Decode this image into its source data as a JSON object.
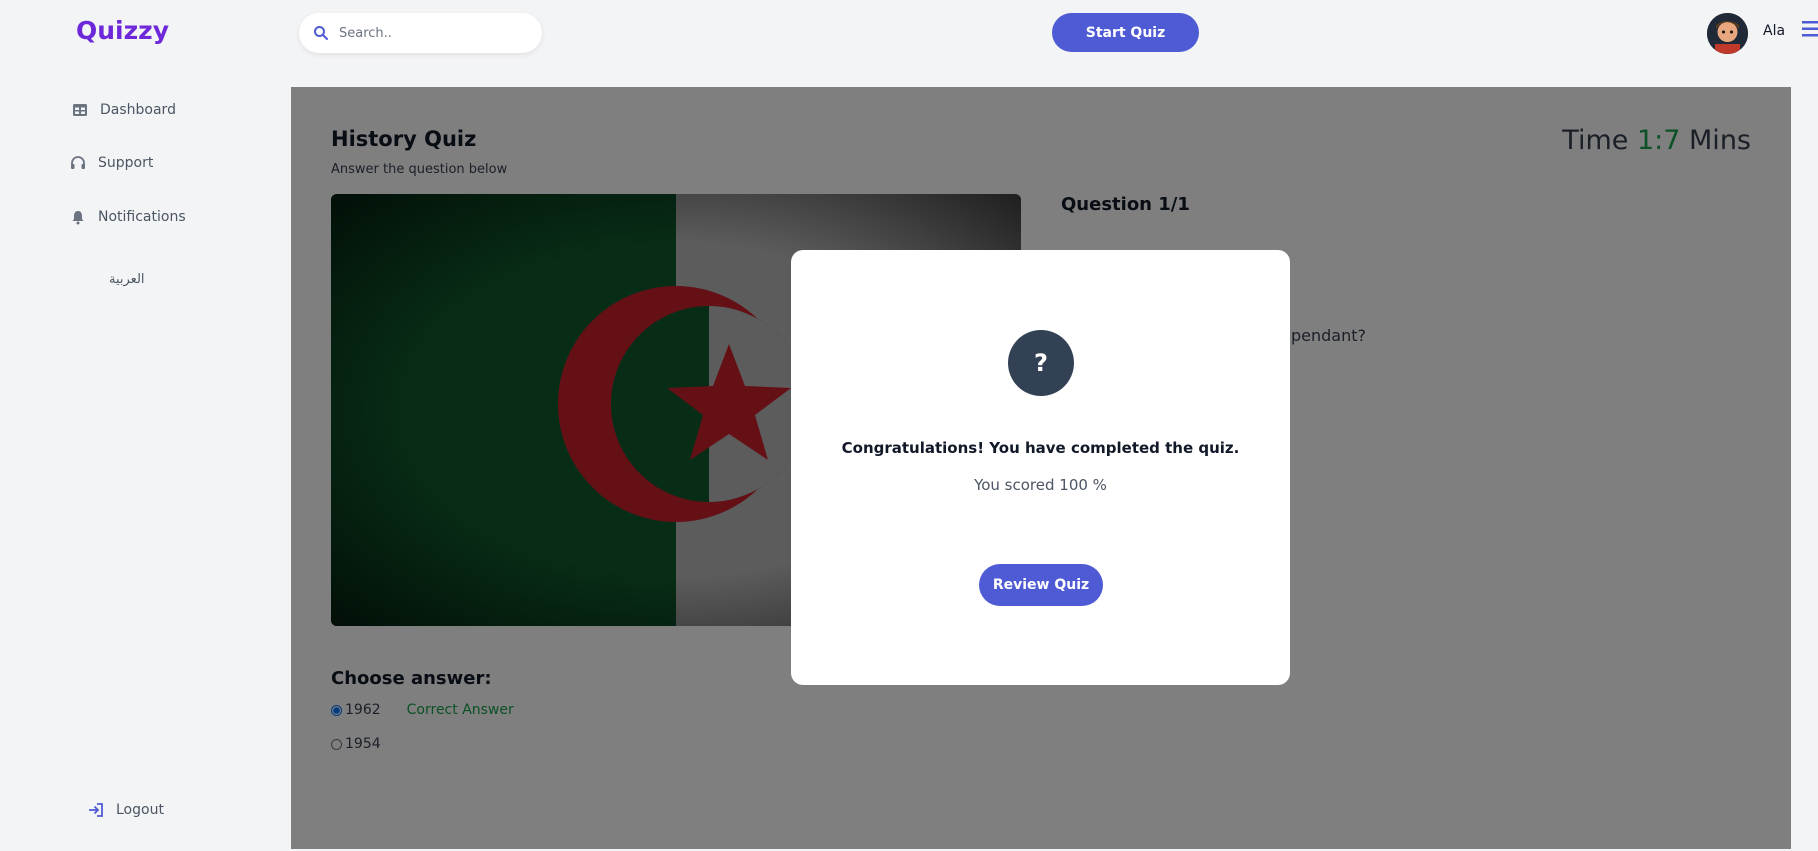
{
  "header": {
    "logo": "Quizzy",
    "search_placeholder": "Search..",
    "start_button": "Start Quiz",
    "username": "Ala"
  },
  "sidebar": {
    "items": [
      {
        "label": "Dashboard",
        "icon": "table-icon"
      },
      {
        "label": "Support",
        "icon": "headphones-icon"
      },
      {
        "label": "Notifications",
        "icon": "bell-icon"
      }
    ],
    "language": "العربية",
    "logout": "Logout"
  },
  "quiz": {
    "title": "History Quiz",
    "subtitle": "Answer the question below",
    "time_label": "Time",
    "time_value": "1:7",
    "time_unit": "Mins",
    "question_label": "Question 1/1",
    "question_text_visible": "pendant?",
    "choose_label": "Choose answer:",
    "options": [
      {
        "label": "1962",
        "selected": true,
        "note": "Correct Answer"
      },
      {
        "label": "1954",
        "selected": false
      }
    ]
  },
  "modal": {
    "icon_glyph": "?",
    "title": "Congratulations! You have completed the quiz.",
    "score": "You scored 100 %",
    "review_button": "Review Quiz"
  },
  "colors": {
    "accent": "#4f5bd5",
    "logo": "#6d28d9",
    "correct": "#16a34a"
  }
}
